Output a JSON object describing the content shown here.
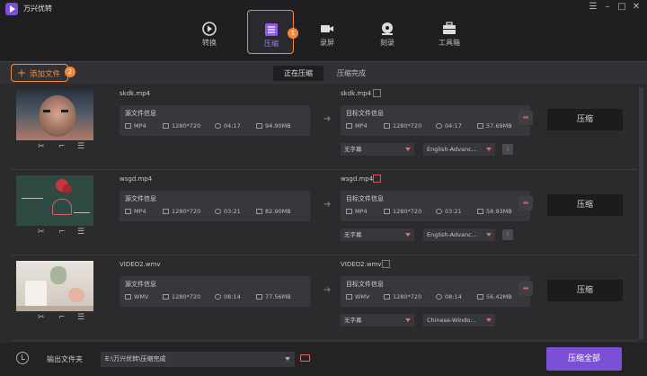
{
  "app": {
    "title": "万兴优转"
  },
  "nav": {
    "items": [
      {
        "label": "转换",
        "icon": "convert-icon"
      },
      {
        "label": "压缩",
        "icon": "compress-icon"
      },
      {
        "label": "录屏",
        "icon": "record-icon"
      },
      {
        "label": "刻录",
        "icon": "burn-icon"
      },
      {
        "label": "工具箱",
        "icon": "toolbox-icon"
      }
    ],
    "badge1": "1"
  },
  "toolbar": {
    "add_label": "添加文件",
    "badge2": "2",
    "tabs": [
      "正在压缩",
      "压缩完成"
    ]
  },
  "rows": [
    {
      "filename": "skdk.mp4",
      "src_header": "源文件信息",
      "src": {
        "format": "MP4",
        "res": "1280*720",
        "dur": "04:17",
        "size": "94.90MB"
      },
      "dst_name": "skdk.mp4",
      "dst_header": "目标文件信息",
      "dst": {
        "format": "MP4",
        "res": "1280*720",
        "dur": "04:17",
        "size": "57.69MB"
      },
      "subtitle": "无字幕",
      "audio": "English-Advanc...",
      "compress_label": "压缩"
    },
    {
      "filename": "wsgd.mp4",
      "src_header": "源文件信息",
      "src": {
        "format": "MP4",
        "res": "1280*720",
        "dur": "03:21",
        "size": "82.90MB"
      },
      "dst_name": "wsgd.mp4",
      "dst_header": "目标文件信息",
      "dst": {
        "format": "MP4",
        "res": "1280*720",
        "dur": "03:21",
        "size": "58.93MB"
      },
      "subtitle": "无字幕",
      "audio": "English-Advanc...",
      "compress_label": "压缩"
    },
    {
      "filename": "VIDEO2.wmv",
      "src_header": "源文件信息",
      "src": {
        "format": "WMV",
        "res": "1280*720",
        "dur": "08:14",
        "size": "77.56MB"
      },
      "dst_name": "VIDEO2.wmv",
      "dst_header": "目标文件信息",
      "dst": {
        "format": "WMV",
        "res": "1280*720",
        "dur": "08:14",
        "size": "56.42MB"
      },
      "subtitle": "无字幕",
      "audio": "Chinese-Windo...",
      "compress_label": "压缩"
    }
  ],
  "footer": {
    "output_label": "输出文件夹",
    "output_path": "E:\\万兴优转\\压缩完成",
    "all_label": "压缩全部"
  },
  "colors": {
    "accent": "#7b4fd6",
    "highlight": "#f08a3a",
    "edit": "#e05050"
  }
}
